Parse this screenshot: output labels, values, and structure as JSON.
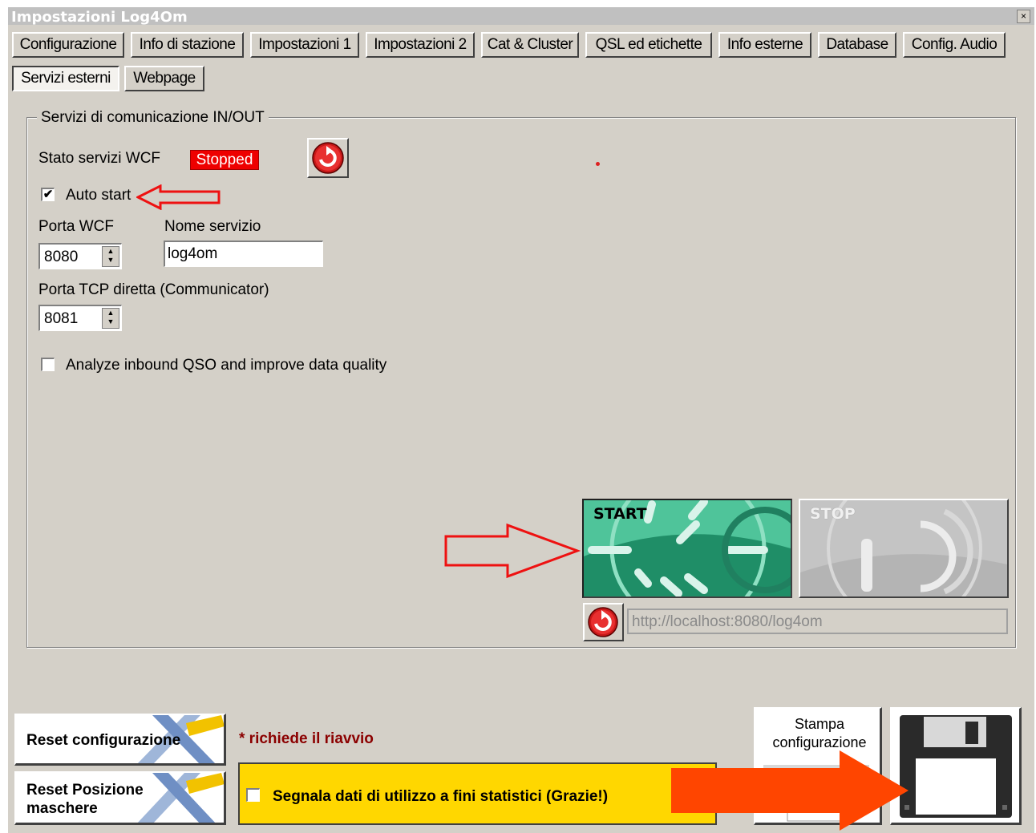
{
  "window": {
    "title": "Impostazioni Log4Om",
    "close": "×"
  },
  "tabs": [
    {
      "label": "Configurazione",
      "active": false
    },
    {
      "label": "Info di stazione",
      "active": false
    },
    {
      "label": "Impostazioni 1",
      "active": false
    },
    {
      "label": "Impostazioni 2",
      "active": false
    },
    {
      "label": "Cat & Cluster",
      "active": false
    },
    {
      "label": "QSL ed etichette",
      "active": false
    },
    {
      "label": "Info esterne",
      "active": false
    },
    {
      "label": "Database",
      "active": false
    },
    {
      "label": "Config. Audio",
      "active": false
    },
    {
      "label": "Servizi esterni",
      "active": true
    },
    {
      "label": "Webpage",
      "active": false
    }
  ],
  "services": {
    "group_title": "Servizi di comunicazione IN/OUT",
    "status_label": "Stato servizi WCF",
    "status_value": "Stopped",
    "auto_start_label": "Auto start",
    "auto_start_checked": true,
    "wcf_port_label": "Porta WCF",
    "wcf_port_value": "8080",
    "service_name_label": "Nome servizio",
    "service_name_value": "log4om",
    "tcp_port_label": "Porta TCP diretta (Communicator)",
    "tcp_port_value": "8081",
    "analyze_label": "Analyze inbound QSO and improve data quality",
    "analyze_checked": false,
    "start_label": "START",
    "stop_label": "STOP",
    "url_value": "http://localhost:8080/log4om"
  },
  "footer": {
    "reset_config_label": "Reset configurazione",
    "reset_positions_label": "Reset Posizione\nmaschere",
    "restart_note": "* richiede il riavvio",
    "stats_label": "Segnala dati di utilizzo a fini statistici (Grazie!)",
    "stats_checked": false,
    "print_label": "Stampa\nconfigurazione"
  },
  "colors": {
    "window_bg": "#d4d0c8",
    "stopped_red": "#ee0000",
    "annotation_arrow": "#ff4500",
    "stats_yellow": "#ffd700",
    "start_green": "#2fa57c"
  }
}
